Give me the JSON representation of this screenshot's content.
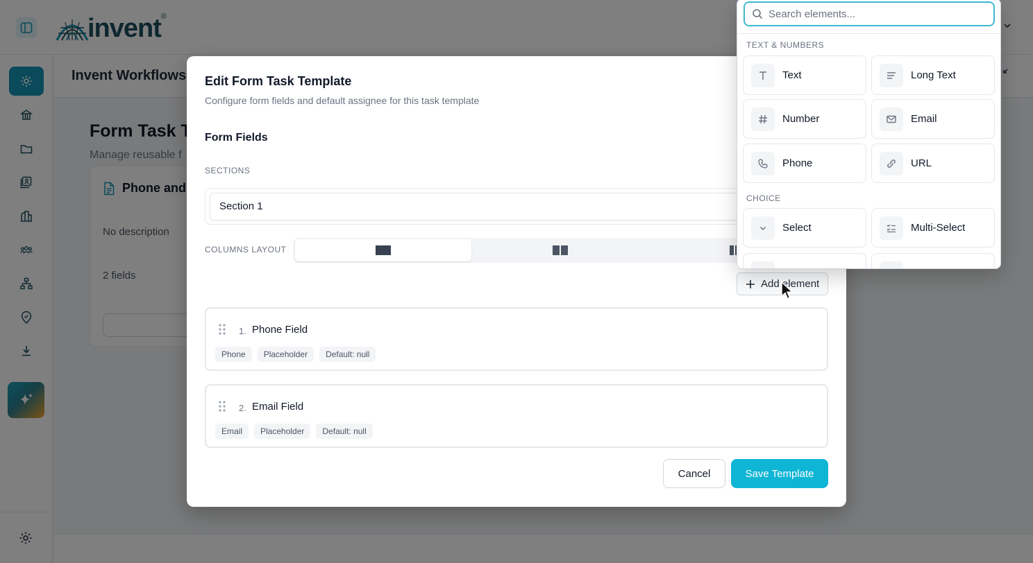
{
  "app": {
    "logo_text": "invent",
    "logo_mark": "®",
    "workspace_title": "Invent Workflows"
  },
  "nav": {
    "icons": [
      "gear-icon",
      "bank-icon",
      "folder-icon",
      "records-icon",
      "chart-icon",
      "users-icon",
      "hierarchy-icon",
      "location-icon",
      "download-icon",
      "sparkle-icon",
      "settings-icon"
    ],
    "accent_color": "#1595b5"
  },
  "page": {
    "heading": "Form Task T",
    "subheading": "Manage reusable f",
    "card": {
      "title": "Phone and",
      "description": "No description",
      "fields_count": "2 fields"
    }
  },
  "modal": {
    "title": "Edit Form Task Template",
    "subtitle": "Configure form fields and default assignee for this task template",
    "form_fields_heading": "Form Fields",
    "sections_label": "SECTIONS",
    "section_name": "Section 1",
    "columns_label": "COLUMNS LAYOUT",
    "columns_selected": 1,
    "add_element_label": "Add element",
    "fields": [
      {
        "number": "1.",
        "name": "Phone Field",
        "tags": [
          "Phone",
          "Placeholder",
          "Default: null"
        ]
      },
      {
        "number": "2.",
        "name": "Email Field",
        "tags": [
          "Email",
          "Placeholder",
          "Default: null"
        ]
      }
    ],
    "cancel_label": "Cancel",
    "save_label": "Save Template",
    "primary_color": "#0fb5d5"
  },
  "dropdown": {
    "search_placeholder": "Search elements...",
    "groups": [
      {
        "label": "TEXT & NUMBERS",
        "items": [
          {
            "label": "Text",
            "icon": "text-icon"
          },
          {
            "label": "Long Text",
            "icon": "long-text-icon"
          },
          {
            "label": "Number",
            "icon": "hash-icon"
          },
          {
            "label": "Email",
            "icon": "mail-icon"
          },
          {
            "label": "Phone",
            "icon": "phone-icon"
          },
          {
            "label": "URL",
            "icon": "link-icon"
          }
        ]
      },
      {
        "label": "CHOICE",
        "items": [
          {
            "label": "Select",
            "icon": "chevron-down-icon"
          },
          {
            "label": "Multi-Select",
            "icon": "list-check-icon"
          }
        ]
      }
    ]
  }
}
